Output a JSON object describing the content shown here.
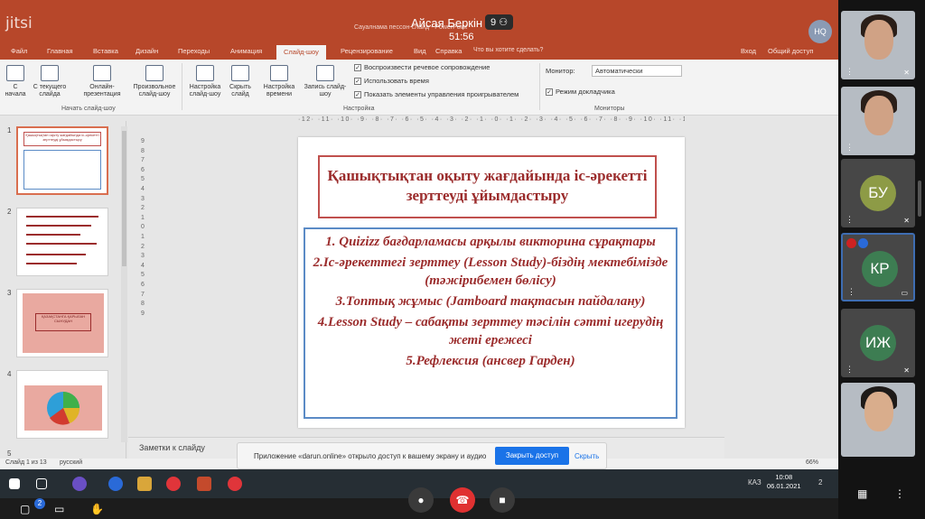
{
  "jitsi": {
    "logo": "jitsi",
    "speaker_name": "Айсая Беркін",
    "participants_count": "9",
    "timer": "51:56",
    "chat_unread": "2"
  },
  "ppt": {
    "doc_title": "Сауалнама пессон-слайд - PowerPoint",
    "search_hint": "Что вы хотите сделать?",
    "account_initials": "HQ",
    "tabs": [
      "Файл",
      "Главная",
      "Вставка",
      "Дизайн",
      "Переходы",
      "Анимация",
      "Слайд-шоу",
      "Рецензирование",
      "Вид",
      "Справка"
    ],
    "active_tab": "Слайд-шоу",
    "signin": "Вход",
    "share": "Общий доступ",
    "ribbon": {
      "buttons": [
        {
          "label": "С начала"
        },
        {
          "label": "С текущего слайда"
        },
        {
          "label": "Онлайн-презентация"
        },
        {
          "label": "Произвольное слайд-шоу"
        },
        {
          "label": "Настройка слайд-шоу"
        },
        {
          "label": "Скрыть слайд"
        },
        {
          "label": "Настройка времени"
        },
        {
          "label": "Запись слайд-шоу"
        }
      ],
      "group_start": "Начать слайд-шоу",
      "group_setup": "Настройка",
      "group_monitors": "Мониторы",
      "checks": [
        {
          "label": "Воспроизвести речевое сопровождение",
          "checked": true
        },
        {
          "label": "Использовать время",
          "checked": true
        },
        {
          "label": "Показать элементы управления проигрывателем",
          "checked": true
        }
      ],
      "monitor_label": "Монитор:",
      "monitor_value": "Автоматически",
      "presenter_view": "Режим докладчика"
    },
    "ruler_text": "·12· ·11· ·10· ·9· ·8· ·7· ·6· ·5· ·4· ·3· ·2· ·1· ·0· ·1· ·2· ·3· ·4· ·5· ·6· ·7· ·8· ·9· ·10· ·11· ·12",
    "vruler": [
      "9",
      "8",
      "7",
      "6",
      "5",
      "4",
      "3",
      "2",
      "1",
      "0",
      "1",
      "2",
      "3",
      "4",
      "5",
      "6",
      "7",
      "8",
      "9"
    ],
    "thumb_numbers": [
      "1",
      "2",
      "3",
      "4",
      "5"
    ],
    "slide": {
      "title": "Қашықтықтан оқыту жағдайында іс-әрекетті зерттеуді ұйымдастыру",
      "items": [
        "1. Quizizz бағдарламасы арқылы викторина сұрақтары",
        "2.Іс-әрекеттегі зерттеу (Lesson Study)-біздің мектебімізде (тәжірибемен бөлісу)",
        "3.Топтық жұмыс (Jamboard тақтасын пайдалану)",
        "4.Lesson Study – сабақты зерттеу тәсілін сәтті игерудің жеті ережесі",
        "5.Рефлексия (ансвер Гарден)"
      ]
    },
    "notes_label": "Заметки к слайду",
    "status": {
      "slide_info": "Слайд 1 из 13",
      "language": "русский",
      "zoom": "66%"
    },
    "thumb_title_1": "Қашықтықтан оқыту жағдайында іс-әрекетті зерттеуді ұйымдастыру",
    "thumb_title_3": "ҚАЗАҚСТАНГА ҚАРЫЛАН СЫНУДАН"
  },
  "notification": {
    "text": "Приложение «darun.online» открыло доступ к вашему экрану и аудио",
    "allow": "Закрыть доступ",
    "hide": "Скрыть"
  },
  "taskbar": {
    "time": "10:08",
    "date": "06.01.2021",
    "lang": "КАЗ",
    "badge": "2"
  },
  "tiles": [
    {
      "type": "video"
    },
    {
      "type": "video"
    },
    {
      "type": "initials",
      "initials": "БУ",
      "color": "#8d9b46"
    },
    {
      "type": "initials",
      "initials": "КР",
      "color": "#3d7d52"
    },
    {
      "type": "initials",
      "initials": "ИЖ",
      "color": "#3d7d52"
    },
    {
      "type": "video"
    }
  ],
  "colors": {
    "ppt_accent": "#b7472a",
    "slide_text": "#9b2c2c",
    "hangup": "#e03131"
  }
}
